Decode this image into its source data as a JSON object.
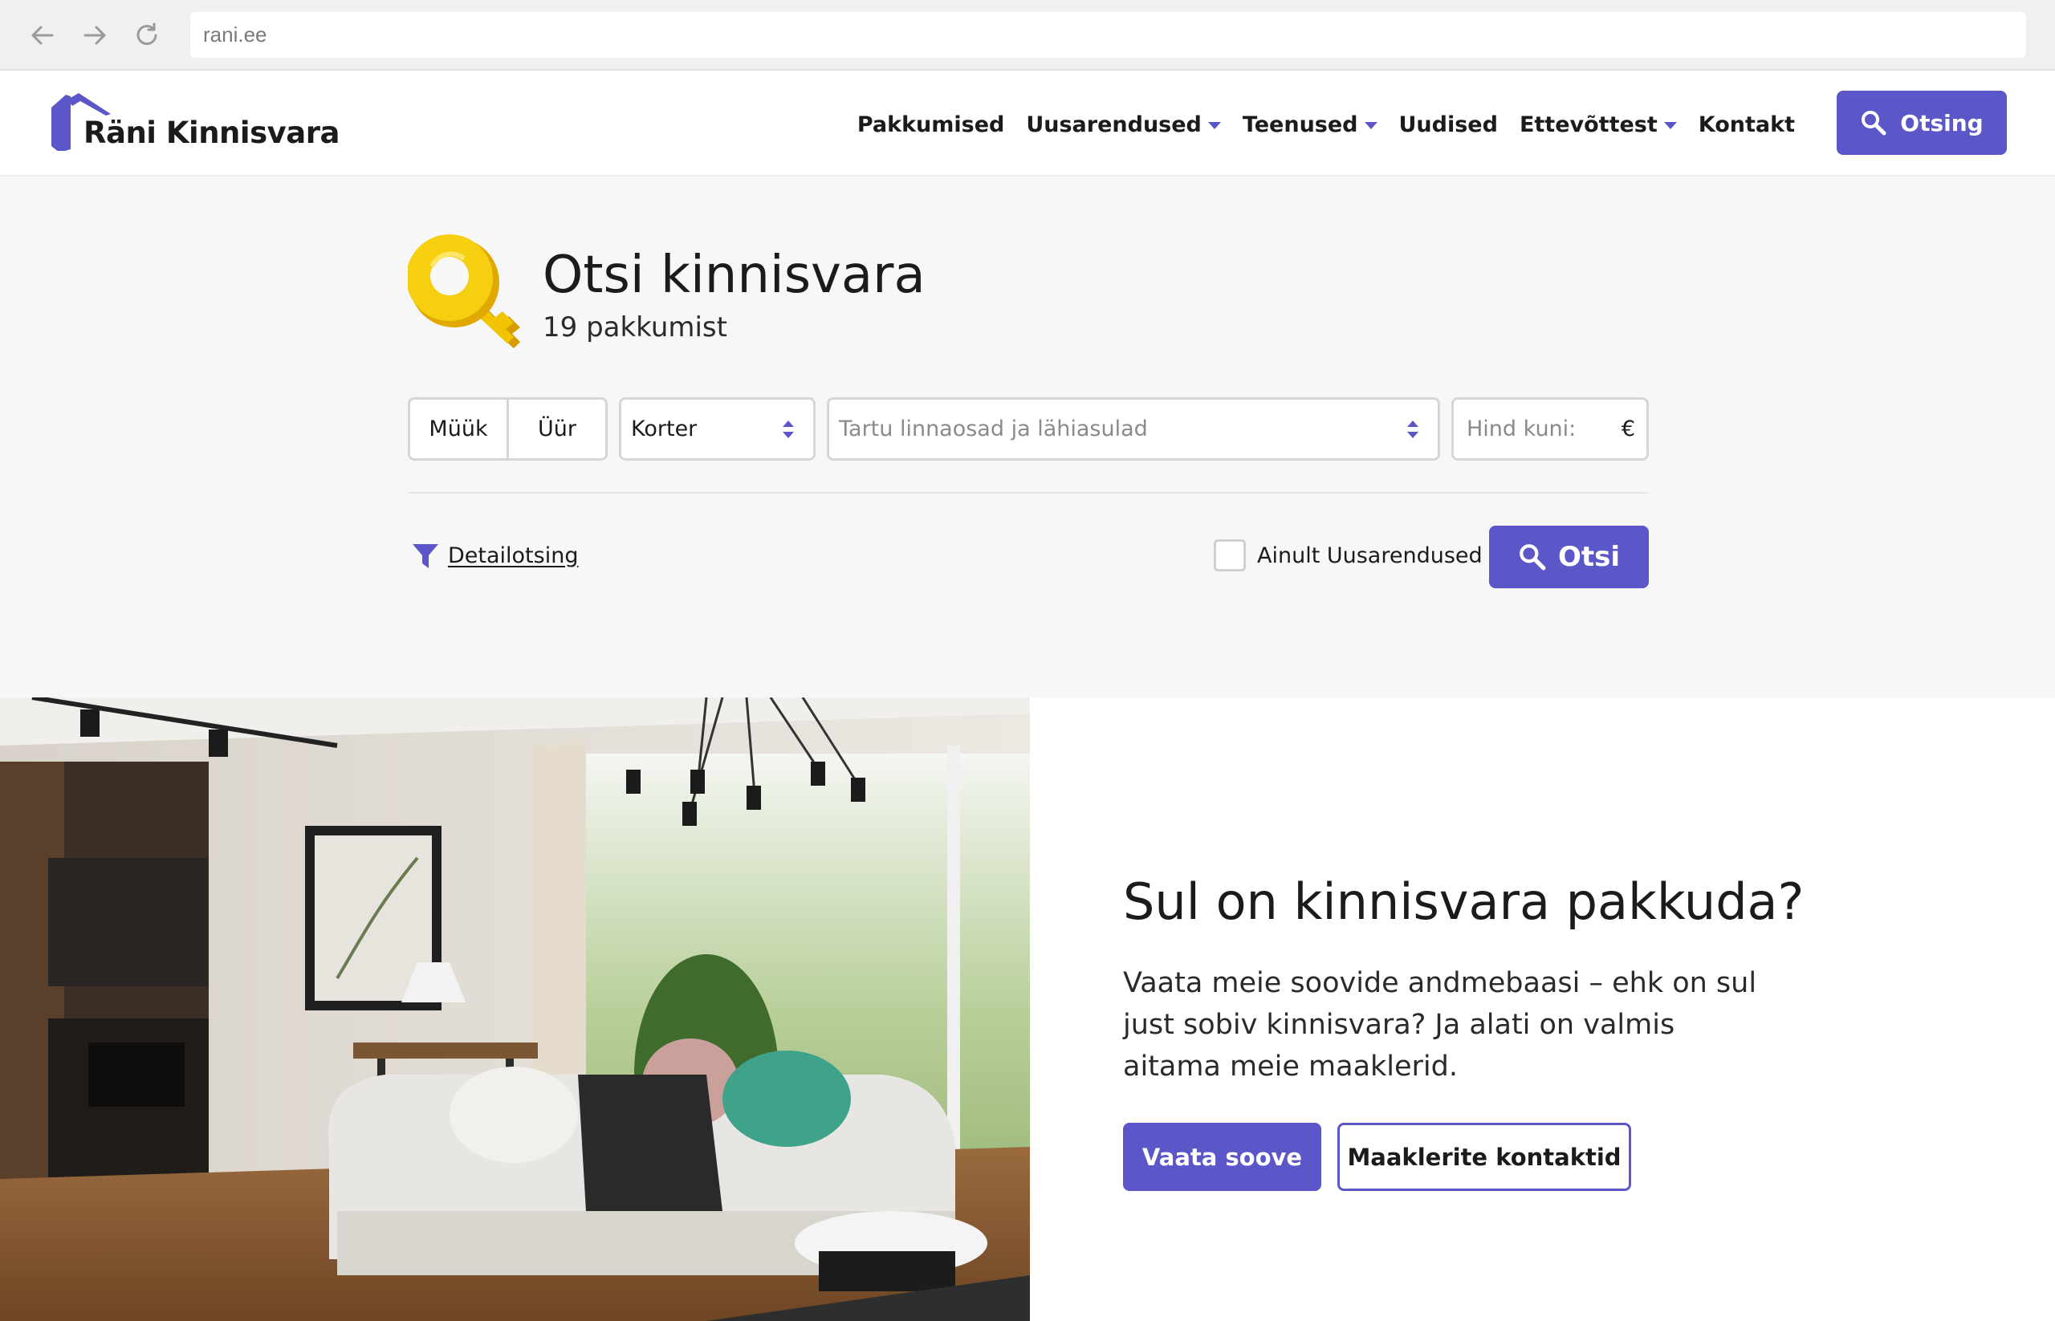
{
  "browser": {
    "url": "rani.ee"
  },
  "header": {
    "logo_text": "Räni Kinnisvara",
    "nav": [
      {
        "label": "Pakkumised",
        "dropdown": false
      },
      {
        "label": "Uusarendused",
        "dropdown": true
      },
      {
        "label": "Teenused",
        "dropdown": true
      },
      {
        "label": "Uudised",
        "dropdown": false
      },
      {
        "label": "Ettevõttest",
        "dropdown": true
      },
      {
        "label": "Kontakt",
        "dropdown": false
      }
    ],
    "search_button": "Otsing",
    "accent_color": "#5b57c9"
  },
  "search": {
    "title": "Otsi kinnisvara",
    "count": "19 pakkumist",
    "deal_types": [
      "Müük",
      "Üür"
    ],
    "property_type": "Korter",
    "area_placeholder": "Tartu linnaosad ja lähiasulad",
    "price_placeholder": "Hind kuni:",
    "currency": "€",
    "detail_link": "Detailotsing",
    "new_dev_only_label": "Ainult Uusarendused",
    "new_dev_only_checked": false,
    "submit_label": "Otsi"
  },
  "promo": {
    "title": "Sul on kinnisvara pakkuda?",
    "text": "Vaata meie soovide andmebaasi – ehk on sul just sobiv kinnisvara? Ja alati on valmis aitama meie maaklerid.",
    "primary_button": "Vaata soove",
    "secondary_button": "Maaklerite kontaktid"
  },
  "icons": {
    "header_search": "search-icon",
    "hero": "key-icon",
    "detail": "filter-icon",
    "submit": "search-icon"
  }
}
